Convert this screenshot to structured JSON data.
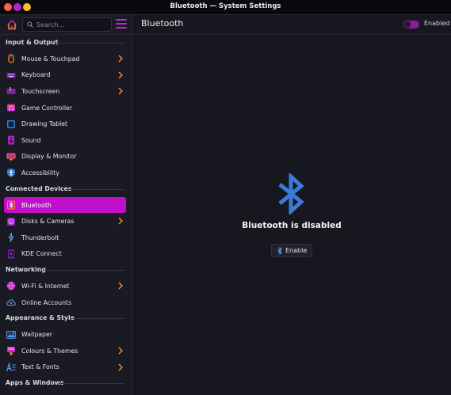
{
  "window": {
    "title": "Bluetooth — System Settings"
  },
  "sidebar": {
    "search_placeholder": "Search...",
    "sections": [
      {
        "header": "Input & Output",
        "items": [
          {
            "label": "Mouse & Touchpad",
            "icon": "mouse-icon",
            "chevron": true
          },
          {
            "label": "Keyboard",
            "icon": "keyboard-icon",
            "chevron": true
          },
          {
            "label": "Touchscreen",
            "icon": "touchscreen-icon",
            "chevron": true
          },
          {
            "label": "Game Controller",
            "icon": "game-controller-icon",
            "chevron": false
          },
          {
            "label": "Drawing Tablet",
            "icon": "drawing-tablet-icon",
            "chevron": false
          },
          {
            "label": "Sound",
            "icon": "speaker-icon",
            "chevron": false
          },
          {
            "label": "Display & Monitor",
            "icon": "monitor-icon",
            "chevron": false
          },
          {
            "label": "Accessibility",
            "icon": "accessibility-icon",
            "chevron": false
          }
        ]
      },
      {
        "header": "Connected Devices",
        "items": [
          {
            "label": "Bluetooth",
            "icon": "bluetooth-icon",
            "chevron": false,
            "active": true
          },
          {
            "label": "Disks & Cameras",
            "icon": "disks-icon",
            "chevron": true
          },
          {
            "label": "Thunderbolt",
            "icon": "thunderbolt-icon",
            "chevron": false
          },
          {
            "label": "KDE Connect",
            "icon": "kde-connect-icon",
            "chevron": false
          }
        ]
      },
      {
        "header": "Networking",
        "items": [
          {
            "label": "Wi-Fi & Internet",
            "icon": "globe-icon",
            "chevron": true
          },
          {
            "label": "Online Accounts",
            "icon": "cloud-icon",
            "chevron": false
          }
        ]
      },
      {
        "header": "Appearance & Style",
        "items": [
          {
            "label": "Wallpaper",
            "icon": "wallpaper-icon",
            "chevron": false
          },
          {
            "label": "Colours & Themes",
            "icon": "palette-icon",
            "chevron": true
          },
          {
            "label": "Text & Fonts",
            "icon": "text-fonts-icon",
            "chevron": true
          }
        ]
      },
      {
        "header": "Apps & Windows",
        "items": []
      }
    ]
  },
  "content": {
    "title": "Bluetooth",
    "toggle_label": "Enabled",
    "toggle_on": true,
    "message": "Bluetooth is disabled",
    "enable_button": "Enable"
  },
  "colors": {
    "accent": "#c10fc9",
    "bluetooth_blue": "#3a7bd5",
    "background": "#17171f"
  }
}
